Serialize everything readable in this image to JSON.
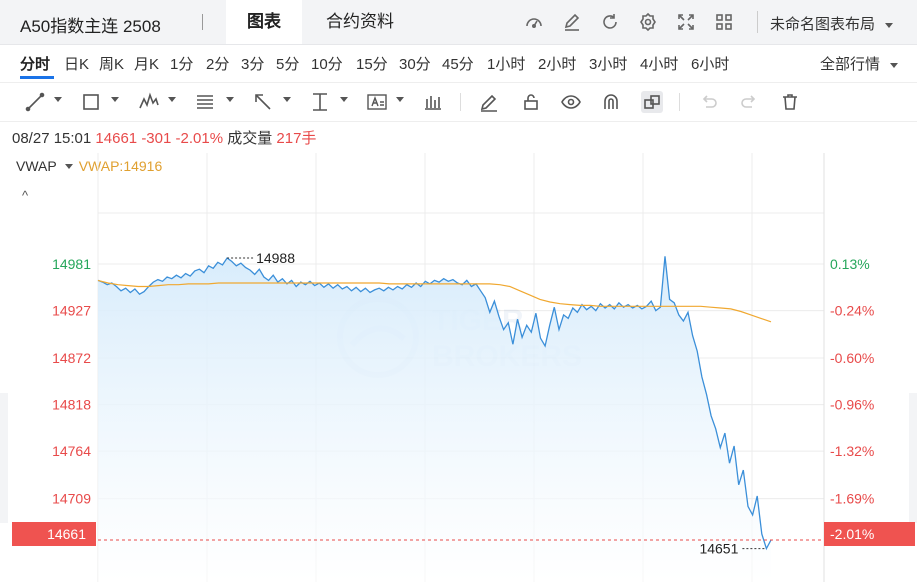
{
  "header": {
    "title": "A50指数主连 2508",
    "tabs": [
      {
        "label": "图表",
        "active": true
      },
      {
        "label": "合约资料",
        "active": false
      }
    ],
    "layout_label": "未命名图表布局",
    "icons": [
      "speedometer-icon",
      "edit-icon",
      "refresh-icon",
      "gear-icon",
      "fullscreen-icon",
      "grid-icon"
    ]
  },
  "periods": {
    "items": [
      "分时",
      "日K",
      "周K",
      "月K",
      "1分",
      "2分",
      "3分",
      "5分",
      "10分",
      "15分",
      "30分",
      "45分",
      "1小时",
      "2小时",
      "3小时",
      "4小时",
      "6小时"
    ],
    "active": "分时",
    "market_label": "全部行情"
  },
  "draw_tools": [
    "line-tool-icon",
    "rect-tool-icon",
    "pattern-tool-icon",
    "fib-tool-icon",
    "arrow-tool-icon",
    "measure-tool-icon",
    "text-tool-icon",
    "bar-tool-icon",
    "pen-icon",
    "lock-icon",
    "eye-icon",
    "magnet-icon",
    "layers-icon",
    "undo-icon",
    "redo-icon",
    "trash-icon"
  ],
  "info": {
    "datetime": "08/27 15:01",
    "price": "14661",
    "change": "-301",
    "change_pct": "-2.01%",
    "volume_label": "成交量",
    "volume": "217手"
  },
  "indicator": {
    "name": "VWAP",
    "value_text": "VWAP:14916",
    "collapse_glyph": "^"
  },
  "colors": {
    "up": "#26a65b",
    "down": "#e84a4a",
    "price_line": "#3b8fd9",
    "vwap_line": "#f0a830",
    "area_top": "#d8ecfb",
    "grid": "#ececec"
  },
  "chart_data": {
    "type": "area",
    "title": "",
    "xlabel": "",
    "ylabel": "",
    "y_ticks_left": [
      "14981",
      "14927",
      "14872",
      "14818",
      "14764",
      "14709"
    ],
    "y_ticks_right": [
      "0.13%",
      "-0.24%",
      "-0.60%",
      "-0.96%",
      "-1.32%",
      "-1.69%"
    ],
    "prev_close": 14962,
    "ylim": [
      14626,
      15052
    ],
    "last_price": "14661",
    "last_pct": "-2.01%",
    "annotations": {
      "high": "14988",
      "low": "14651"
    },
    "grid": true,
    "series": [
      {
        "type": "area",
        "values": [
          14962,
          14960,
          14957,
          14959,
          14955,
          14950,
          14953,
          14948,
          14952,
          14946,
          14949,
          14955,
          14960,
          14963,
          14961,
          14966,
          14964,
          14968,
          14965,
          14970,
          14967,
          14973,
          14975,
          14971,
          14979,
          14976,
          14983,
          14980,
          14988,
          14984,
          14979,
          14982,
          14977,
          14974,
          14969,
          14975,
          14966,
          14962,
          14968,
          14960,
          14964,
          14958,
          14962,
          14955,
          14960,
          14957,
          14961,
          14956,
          14959,
          14954,
          14958,
          14953,
          14957,
          14952,
          14955,
          14950,
          14954,
          14949,
          14953,
          14948,
          14951,
          14953,
          14950,
          14954,
          14951,
          14955,
          14952,
          14957,
          14954,
          14959,
          14955,
          14961,
          14958,
          14962,
          14960,
          14964,
          14961,
          14963,
          14959,
          14957,
          14962,
          14955,
          14958,
          14950,
          14942,
          14925,
          14938,
          14920,
          14905,
          14913,
          14888,
          14917,
          14896,
          14910,
          14902,
          14924,
          14895,
          14886,
          14910,
          14931,
          14905,
          14922,
          14918,
          14930,
          14925,
          14934,
          14928,
          14932,
          14927,
          14935,
          14930,
          14934,
          14929,
          14936,
          14931,
          14934,
          14930,
          14933,
          14929,
          14932,
          14938,
          14927,
          14931,
          14990,
          14940,
          14936,
          14922,
          14915,
          14925,
          14898,
          14880,
          14850,
          14830,
          14805,
          14790,
          14768,
          14785,
          14750,
          14770,
          14725,
          14742,
          14700,
          14690,
          14712,
          14668,
          14651,
          14661
        ],
        "color": "#3b8fd9"
      },
      {
        "type": "line",
        "values": [
          14962,
          14959,
          14957,
          14956,
          14955,
          14955,
          14956,
          14957,
          14957,
          14958,
          14958,
          14958,
          14959,
          14959,
          14959,
          14959,
          14959,
          14959,
          14959,
          14959,
          14959,
          14959,
          14959,
          14959,
          14959,
          14959,
          14959,
          14959,
          14959,
          14958,
          14958,
          14958,
          14958,
          14958,
          14958,
          14958,
          14958,
          14958,
          14958,
          14958,
          14957,
          14955,
          14950,
          14945,
          14940,
          14937,
          14935,
          14934,
          14933,
          14933,
          14932,
          14932,
          14932,
          14932,
          14932,
          14932,
          14932,
          14932,
          14932,
          14932,
          14932,
          14931,
          14930,
          14929,
          14926,
          14922,
          14918,
          14914
        ],
        "color": "#f0a830"
      }
    ]
  }
}
